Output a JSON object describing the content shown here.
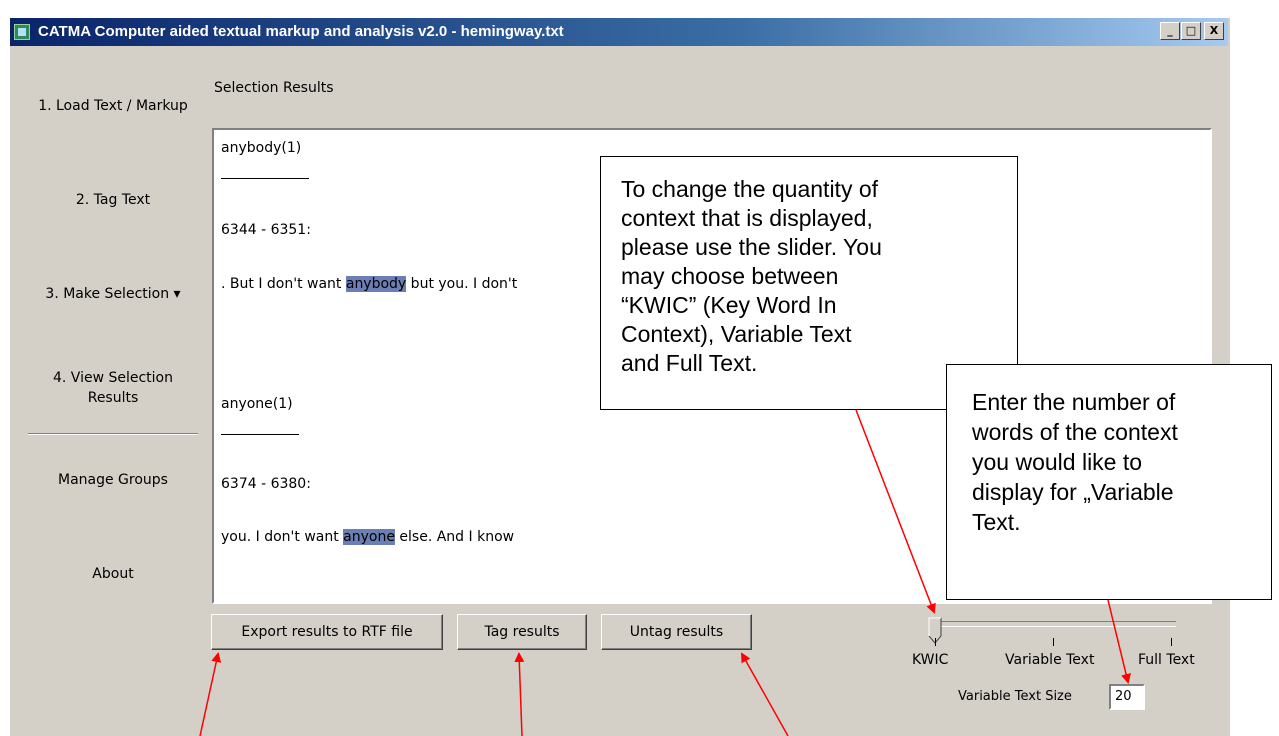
{
  "window": {
    "title": "CATMA Computer aided textual markup and analysis v2.0  - hemingway.txt",
    "controls": {
      "minimize": "_",
      "maximize": "□",
      "close": "X"
    }
  },
  "sidebar": {
    "items": [
      {
        "label": "1. Load Text / Markup"
      },
      {
        "label": "2. Tag Text"
      },
      {
        "label": "3. Make Selection ▾"
      },
      {
        "label_line1": "4. View Selection",
        "label_line2": "Results"
      },
      {
        "label": "Manage Groups"
      },
      {
        "label": "About"
      }
    ]
  },
  "main": {
    "section_title": "Selection Results",
    "results": [
      {
        "heading": "anybody(1)",
        "range": "6344 - 6351:",
        "context_before": ". But I don't want ",
        "keyword": "anybody",
        "context_after": " but you. I don't"
      },
      {
        "heading": "anyone(1)",
        "range": "6374 - 6380:",
        "context_before": "you. I don't want ",
        "keyword": "anyone",
        "context_after": " else. And I know"
      }
    ],
    "buttons": {
      "export": "Export results to RTF file",
      "tag": "Tag results",
      "untag": "Untag results"
    },
    "slider": {
      "labels": [
        "KWIC",
        "Variable Text",
        "Full Text"
      ],
      "selected": "KWIC"
    },
    "variable_text_size": {
      "label": "Variable Text Size",
      "value": "20"
    }
  },
  "callouts": {
    "context_slider": [
      "To change the quantity of",
      "context that is displayed,",
      "please use the slider. You",
      "may choose between",
      "“KWIC” (Key Word In",
      "Context), Variable Text",
      "and Full Text."
    ],
    "variable_size": [
      "Enter the number of",
      "words of the context",
      "you would like to",
      "display for „Variable",
      "Text."
    ]
  },
  "colors": {
    "titlebar_start": "#0a246a",
    "titlebar_end": "#a6caf0",
    "highlight": "#6b7fb5",
    "annotation_arrow": "#ff0000",
    "window_bg": "#d4d0c8"
  }
}
